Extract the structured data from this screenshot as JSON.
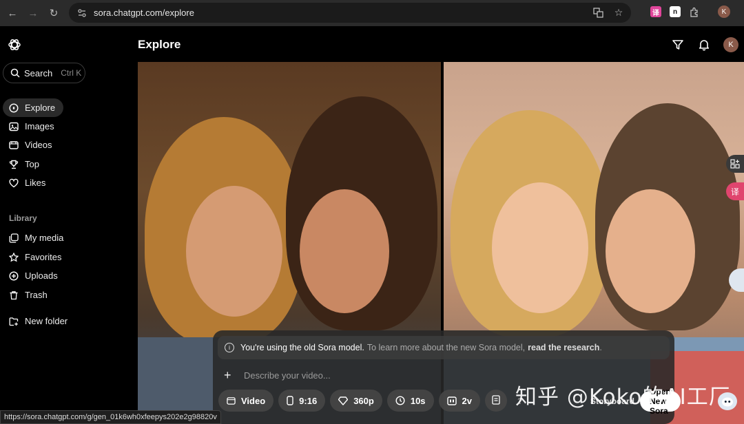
{
  "browser": {
    "url": "sora.chatgpt.com/explore",
    "avatar_letter": "K"
  },
  "sidebar": {
    "search_label": "Search",
    "search_shortcut": "Ctrl K",
    "nav": [
      {
        "label": "Explore",
        "icon": "compass-icon"
      },
      {
        "label": "Images",
        "icon": "image-icon"
      },
      {
        "label": "Videos",
        "icon": "video-icon"
      },
      {
        "label": "Top",
        "icon": "trophy-icon"
      },
      {
        "label": "Likes",
        "icon": "heart-icon"
      }
    ],
    "library_label": "Library",
    "library": [
      {
        "label": "My media",
        "icon": "media-icon"
      },
      {
        "label": "Favorites",
        "icon": "star-icon"
      },
      {
        "label": "Uploads",
        "icon": "upload-icon"
      },
      {
        "label": "Trash",
        "icon": "trash-icon"
      }
    ],
    "new_folder_label": "New folder"
  },
  "header": {
    "title": "Explore",
    "avatar_letter": "K"
  },
  "composer": {
    "notice_strong": "You're using the old Sora model.",
    "notice_muted": "To learn more about the new Sora model,",
    "notice_link": "read the research",
    "notice_end": ".",
    "prompt_placeholder": "Describe your video...",
    "options": {
      "type": "Video",
      "aspect": "9:16",
      "resolution": "360p",
      "duration": "10s",
      "variations": "2v",
      "help": "?"
    },
    "storyboard_label": "Storyboard",
    "open_new_label": "Open New Sora"
  },
  "watermark_text": "知乎 @Koko的AI工厂",
  "status_url": "https://sora.chatgpt.com/g/gen_01k6wh0xfeepys202e2g98820v",
  "colors": {
    "background": "#000000",
    "chrome": "#2b2b2b",
    "active_nav": "#2a2a2a"
  }
}
